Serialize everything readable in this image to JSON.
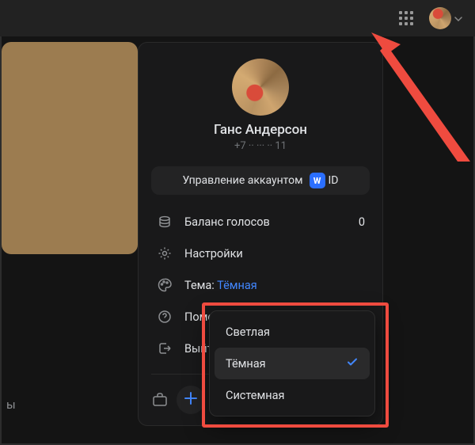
{
  "user": {
    "name": "Ганс Андерсон",
    "phone": "+7 ·· ··· ·· 11"
  },
  "manage": {
    "label": "Управление аккаунтом",
    "badge": "W",
    "id_label": "ID"
  },
  "menu": {
    "balance": {
      "label": "Баланс голосов",
      "value": "0"
    },
    "settings": {
      "label": "Настройки"
    },
    "theme": {
      "label": "Тема:",
      "current": "Тёмная"
    },
    "help": {
      "label": "Помощь"
    },
    "logout": {
      "label": "Выйти"
    }
  },
  "theme_options": [
    {
      "label": "Светлая",
      "selected": false
    },
    {
      "label": "Тёмная",
      "selected": true
    },
    {
      "label": "Системная",
      "selected": false
    }
  ],
  "left": {
    "truncated_tab": "ы"
  },
  "colors": {
    "accent": "#4287ff",
    "annotation": "#ef4b3f",
    "panel_bg": "#19191a",
    "topbar_bg": "#222222"
  }
}
